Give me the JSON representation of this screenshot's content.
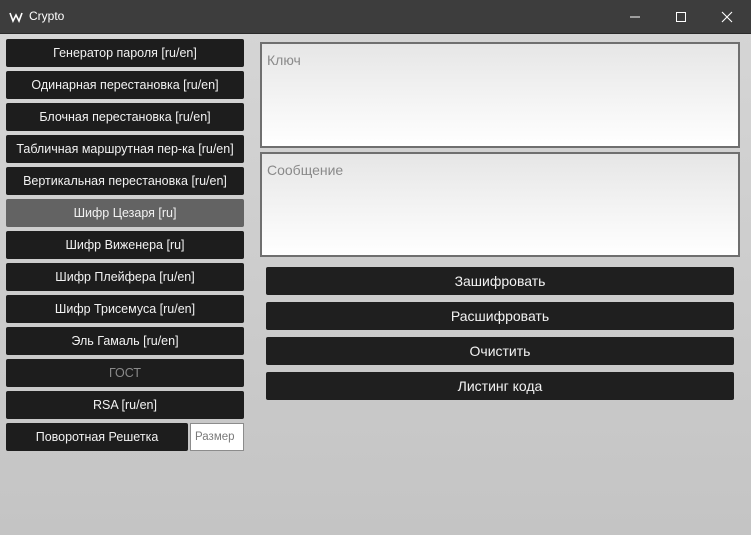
{
  "window": {
    "title": "Crypto"
  },
  "sidebar": {
    "items": [
      {
        "label": "Генератор пароля [ru/en]"
      },
      {
        "label": "Одинарная перестановка [ru/en]"
      },
      {
        "label": "Блочная перестановка [ru/en]"
      },
      {
        "label": "Табличная маршрутная пер-ка [ru/en]"
      },
      {
        "label": "Вертикальная перестановка [ru/en]"
      },
      {
        "label": "Шифр Цезаря [ru]",
        "state": "selected"
      },
      {
        "label": "Шифр Виженера [ru]"
      },
      {
        "label": "Шифр Плейфера [ru/en]"
      },
      {
        "label": "Шифр Трисемуса [ru/en]"
      },
      {
        "label": "Эль Гамаль [ru/en]"
      },
      {
        "label": "ГОСТ",
        "state": "disabled"
      },
      {
        "label": "RSA [ru/en]"
      }
    ],
    "rotating_grid": {
      "label": "Поворотная Решетка",
      "size_placeholder": "Размер"
    }
  },
  "main": {
    "key_placeholder": "Ключ",
    "message_placeholder": "Сообщение",
    "encrypt_label": "Зашифровать",
    "decrypt_label": "Расшифровать",
    "clear_label": "Очистить",
    "listing_label": "Листинг кода"
  },
  "colors": {
    "titlebar": "#3d3d3d",
    "button": "#1d1d1d",
    "button_selected": "#636363",
    "button_text": "#f2f2f2",
    "button_disabled_text": "#8a8a8a",
    "background": "#cfcfcf"
  },
  "icons": {
    "app": "app-icon",
    "minimize": "minimize-icon",
    "maximize": "maximize-icon",
    "close": "close-icon"
  }
}
